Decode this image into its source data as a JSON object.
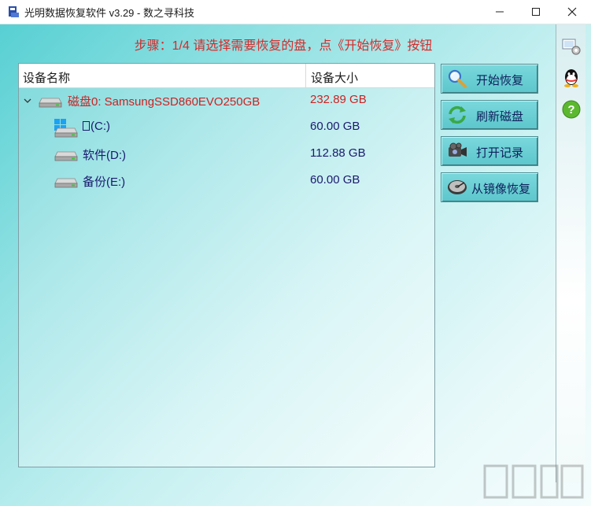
{
  "window": {
    "title": "光明数据恢复软件 v3.29 - 数之寻科技",
    "minimize_icon": "minimize-icon",
    "maximize_icon": "maximize-icon",
    "close_icon": "close-icon"
  },
  "step_text": "步骤：1/4 请选择需要恢复的盘，点《开始恢复》按钮",
  "device_list": {
    "columns": [
      "设备名称",
      "设备大小"
    ],
    "disk": {
      "name": "磁盘0: SamsungSSD860EVO250GB",
      "size": "232.89 GB",
      "expanded": true
    },
    "partitions": [
      {
        "name": "(C:)",
        "size": "60.00 GB",
        "icon": "windows-drive-icon"
      },
      {
        "name": "软件(D:)",
        "size": "112.88 GB",
        "icon": "drive-icon"
      },
      {
        "name": "备份(E:)",
        "size": "60.00 GB",
        "icon": "drive-icon"
      }
    ]
  },
  "buttons": {
    "start_recovery": "开始恢复",
    "refresh_disk": "刷新磁盘",
    "open_record": "打开记录",
    "recover_from_image": "从镜像恢复"
  },
  "side_icons": [
    "settings-icon",
    "qq-icon",
    "help-icon"
  ],
  "colors": {
    "accent_red": "#d62a2a",
    "disk_text": "#cc2222",
    "partition_text": "#1a1a6e",
    "button_face": "#6ccfd4"
  }
}
